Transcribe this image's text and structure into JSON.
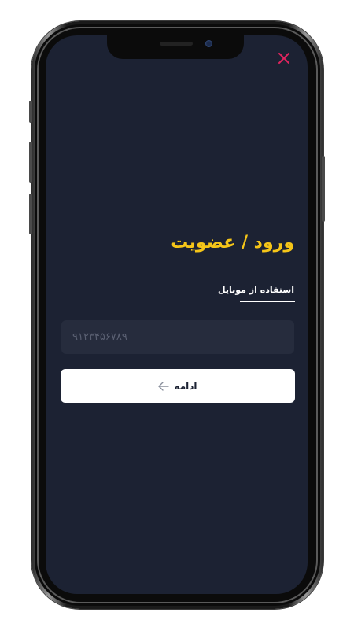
{
  "colors": {
    "screen_bg": "#1c2233",
    "accent_yellow": "#f5c518",
    "close_red": "#e0245e",
    "input_bg": "#262c3d",
    "button_bg": "#ffffff"
  },
  "header": {
    "close_icon": "close-icon"
  },
  "auth": {
    "title": "ورود / عضویت",
    "tab_label": "استفاده از موبایل",
    "phone_placeholder": "۹۱۲۳۴۵۶۷۸۹",
    "phone_value": "",
    "continue_label": "ادامه",
    "continue_icon": "arrow-left-icon"
  }
}
